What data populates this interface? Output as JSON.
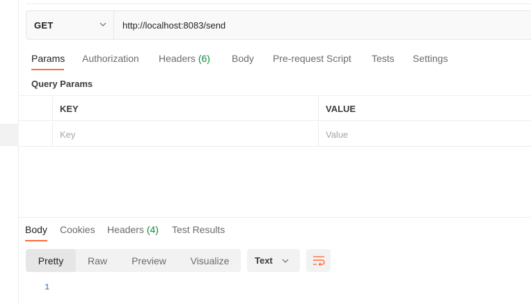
{
  "request": {
    "method": "GET",
    "url": "http://localhost:8083/send",
    "tabs": [
      {
        "label": "Params",
        "count": ""
      },
      {
        "label": "Authorization",
        "count": ""
      },
      {
        "label": "Headers",
        "count": "(6)"
      },
      {
        "label": "Body",
        "count": ""
      },
      {
        "label": "Pre-request Script",
        "count": ""
      },
      {
        "label": "Tests",
        "count": ""
      },
      {
        "label": "Settings",
        "count": ""
      }
    ],
    "active_tab": "Params"
  },
  "query_params": {
    "title": "Query Params",
    "columns": [
      "KEY",
      "VALUE"
    ],
    "key_placeholder": "Key",
    "value_placeholder": "Value"
  },
  "response": {
    "tabs": [
      {
        "label": "Body",
        "count": ""
      },
      {
        "label": "Cookies",
        "count": ""
      },
      {
        "label": "Headers",
        "count": "(4)"
      },
      {
        "label": "Test Results",
        "count": ""
      }
    ],
    "active_tab": "Body",
    "view_modes": [
      "Pretty",
      "Raw",
      "Preview",
      "Visualize"
    ],
    "active_view": "Pretty",
    "format": "Text",
    "line_numbers": [
      "1"
    ]
  },
  "icons": {
    "method_dropdown": "chevron-down-icon",
    "format_dropdown": "chevron-down-icon",
    "wrap": "wrap-lines-icon"
  },
  "colors": {
    "accent": "#ff6c37",
    "count": "#0a8a3a",
    "line_number": "#2b6cb0"
  }
}
